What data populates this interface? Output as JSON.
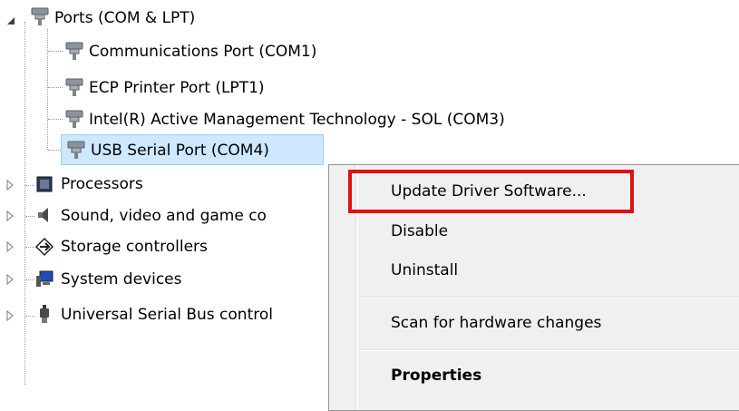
{
  "tree": {
    "ports": {
      "label": "Ports (COM & LPT)",
      "children": [
        "Communications Port (COM1)",
        "ECP Printer Port (LPT1)",
        "Intel(R) Active Management Technology - SOL (COM3)",
        "USB Serial Port (COM4)"
      ]
    },
    "categories": [
      {
        "label": "Processors",
        "icon": "processor-icon"
      },
      {
        "label": "Sound, video and game co",
        "icon": "speaker-icon"
      },
      {
        "label": "Storage controllers",
        "icon": "storage-controller-icon"
      },
      {
        "label": "System devices",
        "icon": "system-devices-icon"
      },
      {
        "label": "Universal Serial Bus control",
        "icon": "usb-icon"
      }
    ]
  },
  "context_menu": {
    "items": [
      {
        "label": "Update Driver Software...",
        "bold": false
      },
      {
        "label": "Disable",
        "bold": false
      },
      {
        "label": "Uninstall",
        "bold": false
      },
      {
        "label": "Scan for hardware changes",
        "bold": false
      },
      {
        "label": "Properties",
        "bold": true
      }
    ]
  },
  "colors": {
    "selection": "#cde8ff",
    "highlight_box": "#e01010",
    "menu_background": "#f0f0f0"
  }
}
